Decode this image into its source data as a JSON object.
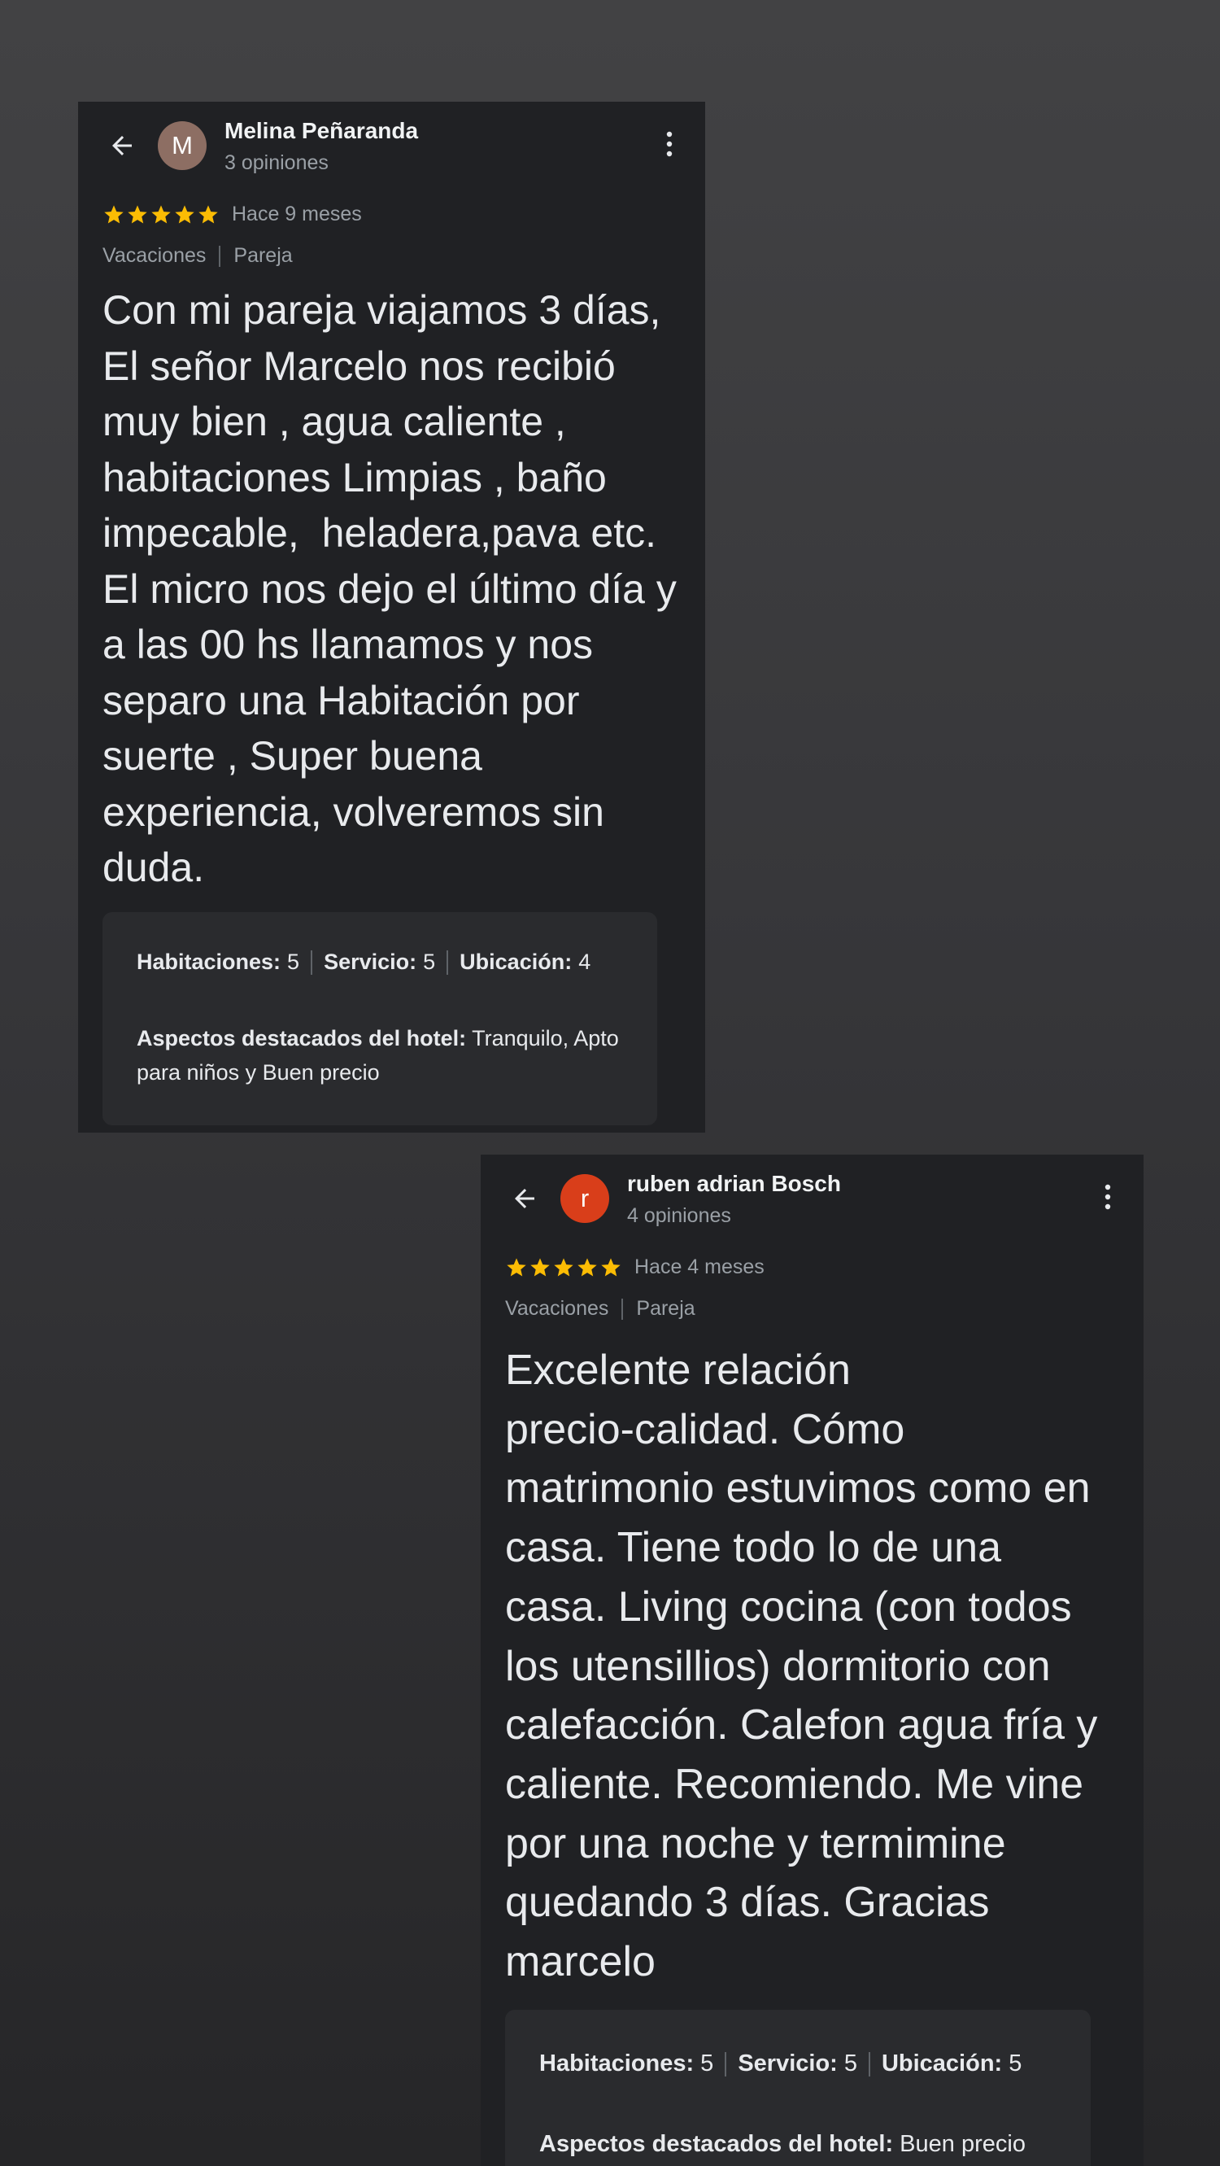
{
  "reviews": [
    {
      "author": "Melina Peñaranda",
      "initial": "M",
      "avatar_color": "#8d6e63",
      "opinions": "3 opiniones",
      "stars": 5,
      "date": "Hace 9 meses",
      "tags": [
        "Vacaciones",
        "Pareja"
      ],
      "text": "Con mi pareja viajamos 3 días,\nEl señor Marcelo nos recibió\nmuy bien , agua caliente ,\nhabitaciones Limpias , baño\nimpecable,  heladera,pava etc.\nEl micro nos dejo el último día y\na las 00 hs llamamos y nos\nseparo una Habitación por\nsuerte , Super buena\nexperiencia, volveremos sin\nduda.",
      "ratings": [
        {
          "label": "Habitaciones:",
          "value": "5"
        },
        {
          "label": "Servicio:",
          "value": "5"
        },
        {
          "label": "Ubicación:",
          "value": "4"
        }
      ],
      "highlights_label": "Aspectos destacados del hotel:",
      "highlights_value": " Tranquilo, Apto para niños y Buen precio"
    },
    {
      "author": "ruben adrian Bosch",
      "initial": "r",
      "avatar_color": "#d93e1a",
      "opinions": "4 opiniones",
      "stars": 5,
      "date": "Hace 4 meses",
      "tags": [
        "Vacaciones",
        "Pareja"
      ],
      "text": "Excelente relación\nprecio-calidad. Cómo\nmatrimonio estuvimos como en\ncasa. Tiene todo lo de una\ncasa. Living cocina (con todos\nlos utensillios) dormitorio con\ncalefacción. Calefon agua fría y\ncaliente. Recomiendo. Me vine\npor una noche y termimine\nquedando 3 días. Gracias\nmarcelo",
      "ratings": [
        {
          "label": "Habitaciones:",
          "value": "5"
        },
        {
          "label": "Servicio:",
          "value": "5"
        },
        {
          "label": "Ubicación:",
          "value": "5"
        }
      ],
      "highlights_label": "Aspectos destacados del hotel:",
      "highlights_value": " Buen precio"
    }
  ],
  "icons": {
    "back": "arrow-back-icon",
    "menu": "more-vert-icon",
    "star": "star-icon"
  },
  "colors": {
    "star": "#fbbc04",
    "card_bg": "#202124",
    "details_bg": "#2a2b2e"
  }
}
